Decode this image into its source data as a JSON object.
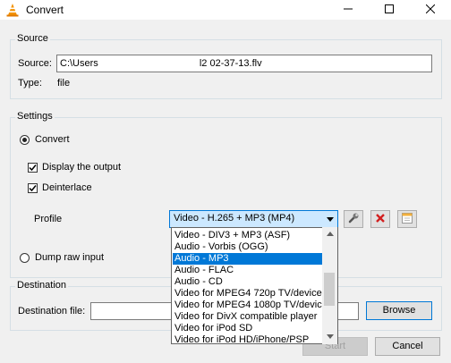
{
  "window": {
    "title": "Convert",
    "icon": "vlc-cone-icon",
    "controls": [
      "minimize-icon",
      "maximize-icon",
      "close-icon"
    ]
  },
  "source": {
    "group_title": "Source",
    "source_label": "Source:",
    "source_value": "C:\\Users                                     l2 02-37-13.flv",
    "type_label": "Type:",
    "type_value": "file"
  },
  "settings": {
    "group_title": "Settings",
    "convert_label": "Convert",
    "display_output_label": "Display the output",
    "deinterlace_label": "Deinterlace",
    "profile_label": "Profile",
    "profile_selected": "Video - H.265 + MP3 (MP4)",
    "dump_raw_label": "Dump raw input",
    "profile_tool_icons": [
      "wrench-icon",
      "delete-icon",
      "new-profile-icon"
    ]
  },
  "profile_options": [
    "Video - DIV3 + MP3 (ASF)",
    "Audio - Vorbis (OGG)",
    "Audio - MP3",
    "Audio - FLAC",
    "Audio - CD",
    "Video for MPEG4 720p TV/device",
    "Video for MPEG4 1080p TV/device",
    "Video for DivX compatible player",
    "Video for iPod SD",
    "Video for iPod HD/iPhone/PSP"
  ],
  "highlighted_option": "Audio - MP3",
  "destination": {
    "group_title": "Destination",
    "file_label": "Destination file:",
    "file_value": "",
    "browse_label": "Browse"
  },
  "buttons": {
    "start_label": "Start",
    "cancel_label": "Cancel"
  },
  "colors": {
    "accent": "#0078d7",
    "vlc_orange": "#f39200"
  }
}
